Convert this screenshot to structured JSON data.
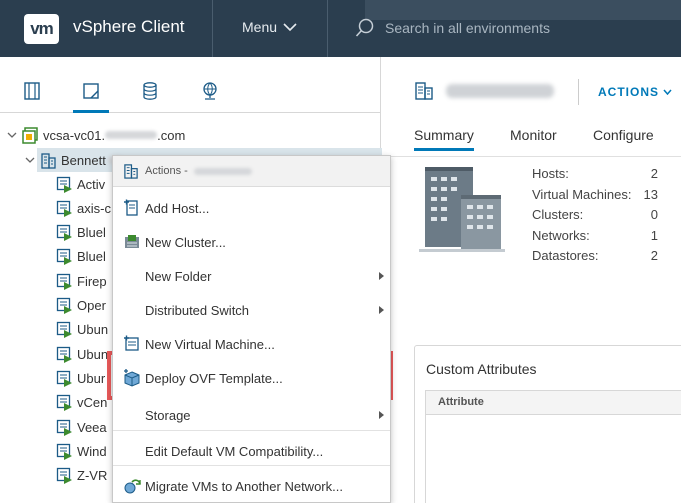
{
  "header": {
    "logo": "vm",
    "app_title": "vSphere Client",
    "menu_label": "Menu",
    "search_placeholder": "Search in all environments"
  },
  "nav_tabs": [
    {
      "icon": "hosts-clusters-icon",
      "active": false
    },
    {
      "icon": "vms-templates-icon",
      "active": true
    },
    {
      "icon": "storage-icon",
      "active": false
    },
    {
      "icon": "networking-icon",
      "active": false
    }
  ],
  "tree": {
    "root": {
      "label": "vcsa-vc01.",
      "label_suffix": ".com"
    },
    "datacenter": {
      "label": "Bennett"
    },
    "vms": [
      {
        "label": "Activ"
      },
      {
        "label": "axis-c"
      },
      {
        "label": "Bluel"
      },
      {
        "label": "Bluel"
      },
      {
        "label": "Firep"
      },
      {
        "label": "Oper"
      },
      {
        "label": "Ubun"
      },
      {
        "label": "Ubun"
      },
      {
        "label": "Ubur"
      },
      {
        "label": "vCen"
      },
      {
        "label": "Veea"
      },
      {
        "label": "Wind"
      },
      {
        "label": "Z-VR"
      }
    ]
  },
  "context_menu": {
    "header": "Actions - ",
    "items": [
      {
        "label": "Add Host...",
        "icon": "add-host-icon",
        "submenu": false
      },
      {
        "label": "New Cluster...",
        "icon": "new-cluster-icon",
        "submenu": false
      },
      {
        "label": "New Folder",
        "icon": "",
        "submenu": true
      },
      {
        "label": "Distributed Switch",
        "icon": "",
        "submenu": true
      },
      {
        "label": "New Virtual Machine...",
        "icon": "new-vm-icon",
        "submenu": false
      },
      {
        "label": "Deploy OVF Template...",
        "icon": "deploy-ovf-icon",
        "submenu": false,
        "highlighted": true
      },
      {
        "label": "Storage",
        "icon": "",
        "submenu": true
      },
      {
        "label": "Edit Default VM Compatibility...",
        "icon": "",
        "submenu": false
      },
      {
        "label": "Migrate VMs to Another Network...",
        "icon": "migrate-network-icon",
        "submenu": false
      }
    ]
  },
  "right_panel": {
    "actions_label": "ACTIONS",
    "tabs": [
      "Summary",
      "Monitor",
      "Configure"
    ],
    "active_tab": "Summary",
    "stats": [
      {
        "label": "Hosts:",
        "value": "2"
      },
      {
        "label": "Virtual Machines:",
        "value": "13"
      },
      {
        "label": "Clusters:",
        "value": "0"
      },
      {
        "label": "Networks:",
        "value": "1"
      },
      {
        "label": "Datastores:",
        "value": "2"
      }
    ],
    "custom_attributes": {
      "title": "Custom Attributes",
      "column": "Attribute"
    }
  },
  "colors": {
    "header_bg": "#2b3e4f",
    "accent": "#0079b8",
    "vm_green": "#3c8a2e",
    "highlight_border": "#e8595a",
    "selection": "#d9e4ea"
  }
}
